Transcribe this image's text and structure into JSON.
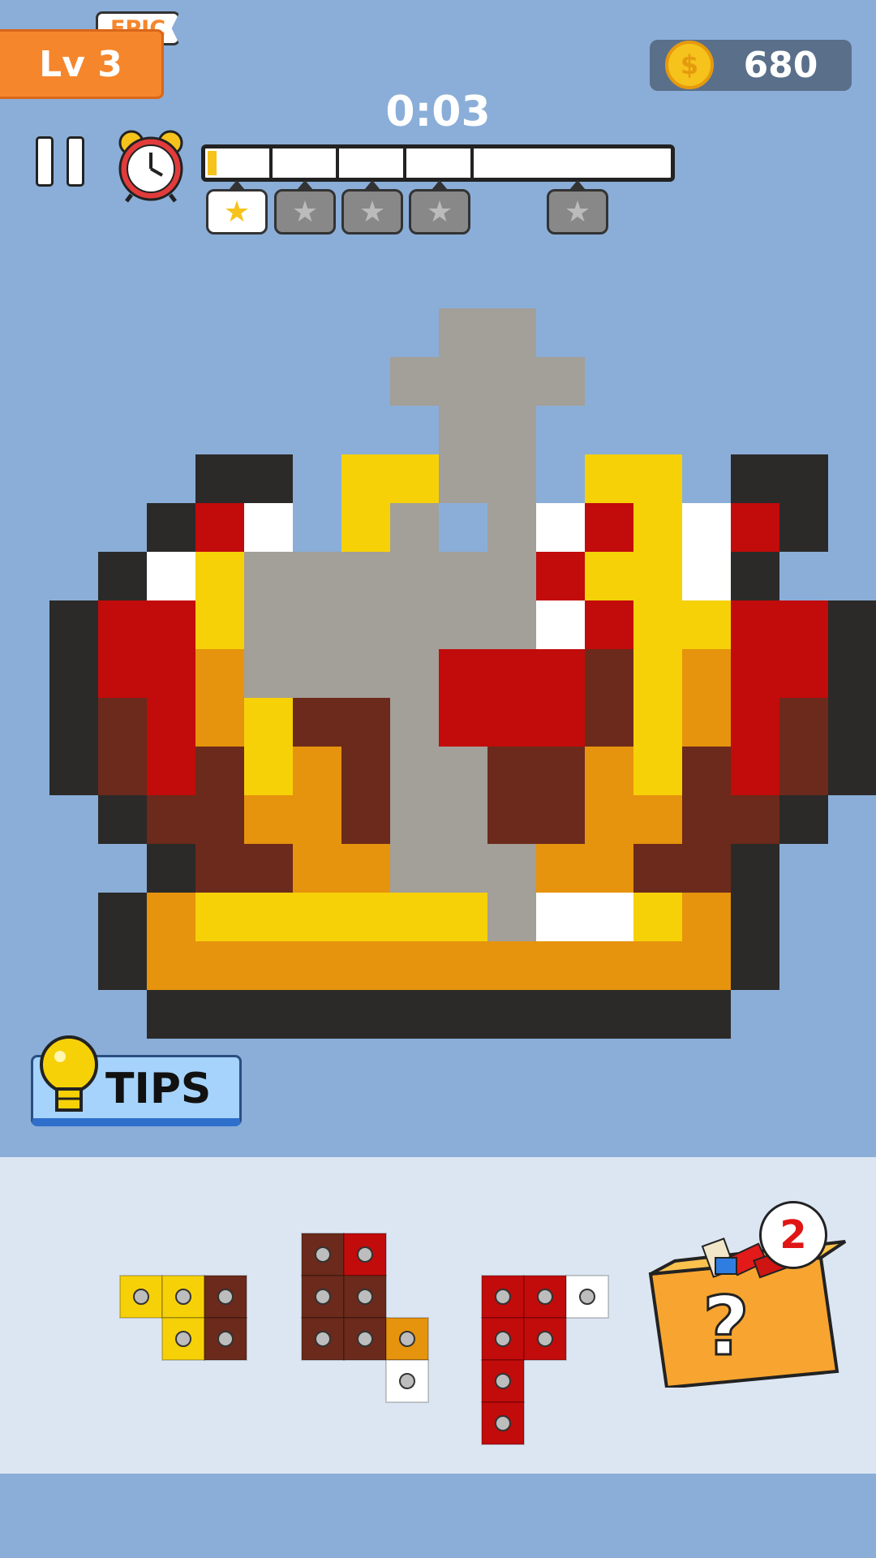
{
  "header": {
    "level_label": "Lv 3",
    "difficulty_tag": "EPIC",
    "coin_count": "680",
    "coin_symbol": "$",
    "timer": "0:03",
    "progress": 0.02,
    "stars": [
      {
        "earned": true
      },
      {
        "earned": false
      },
      {
        "earned": false
      },
      {
        "earned": false
      },
      {
        "earned": false
      }
    ]
  },
  "tips": {
    "label": "TIPS"
  },
  "mystery_box": {
    "count": "2",
    "symbol": "?"
  },
  "colors": {
    "background": "#8aaed8",
    "black": "#2b2a29",
    "red": "#c20b0b",
    "white": "#ffffff",
    "yellow": "#f6d108",
    "orange": "#e6930d",
    "brown": "#6b2a1b",
    "empty": "#a39f99",
    "accent_orange": "#f5862b"
  },
  "board_rows": [
    "........XX......",
    ".......GGGG.....",
    "........GG......",
    "...KK.YYGG.YY.KK",
    "..KRW.YG GWRYWRK",
    ".KWYGGGGGGRYYWK.",
    "KRRYGGGGGGWRYYRRK",
    "KRROGGGGRRRBYORRK",
    "KBROYBBGRRRBYORBK",
    "KBRBYOBGGBBOYBRBK",
    ".KBBOOBGGBBOOBBK.",
    "..KBBOOGGGOOBBK..",
    ".KOYYYYYYGWWYOK..",
    ".KOOOOOOOOOOOOK..",
    "..KKKKKKKKKKKK..."
  ]
}
